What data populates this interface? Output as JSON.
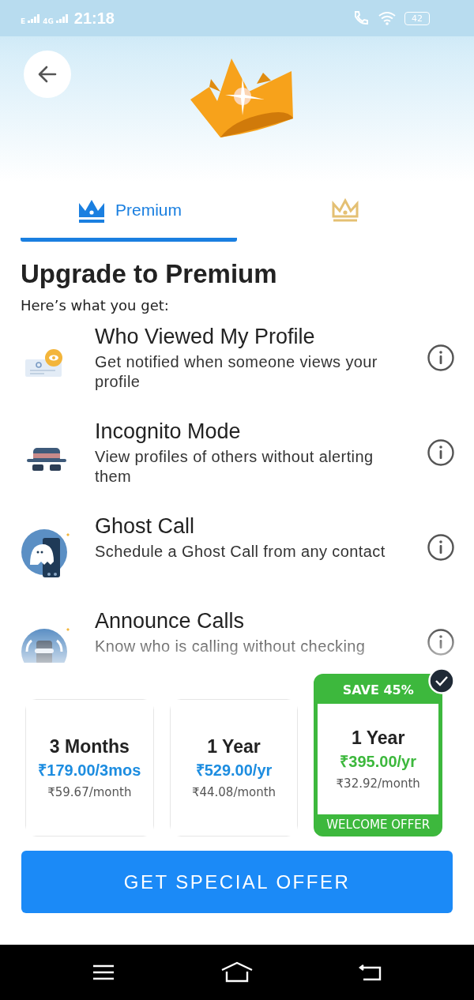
{
  "status_bar": {
    "network_1": "E",
    "network_2": "4G",
    "time": "21:18",
    "battery": "42"
  },
  "tabs": [
    {
      "kind": "premium",
      "label": "Premium",
      "selected": true
    },
    {
      "kind": "gold",
      "selected": false
    }
  ],
  "heading": "Upgrade to Premium",
  "subheading": "Here’s what you get:",
  "features": [
    {
      "kind": "profile",
      "title": "Who Viewed My Profile",
      "description": "Get notified when someone views your profile"
    },
    {
      "kind": "incognito",
      "title": "Incognito Mode",
      "description": "View profiles of others without alerting them"
    },
    {
      "kind": "ghost",
      "title": "Ghost Call",
      "description": "Schedule a Ghost Call from any contact"
    },
    {
      "kind": "announce",
      "title": "Announce Calls",
      "description": "Know who is calling without checking"
    }
  ],
  "plans": [
    {
      "duration": "3 Months",
      "price": "₹179.00/3mos",
      "per_month": "₹59.67/month",
      "selected": false
    },
    {
      "duration": "1 Year",
      "price": "₹529.00/yr",
      "per_month": "₹44.08/month",
      "selected": false
    },
    {
      "duration": "1 Year",
      "price": "₹395.00/yr",
      "per_month": "₹32.92/month",
      "badge": "SAVE 45%",
      "footer": "WELCOME OFFER",
      "selected": true
    }
  ],
  "cta": "GET SPECIAL OFFER"
}
